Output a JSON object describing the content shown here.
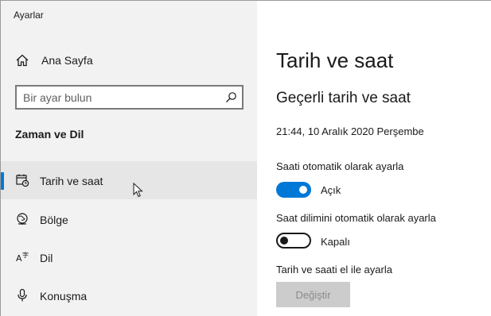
{
  "app": {
    "title": "Ayarlar"
  },
  "sidebar": {
    "home_label": "Ana Sayfa",
    "search_placeholder": "Bir ayar bulun",
    "section_title": "Zaman ve Dil",
    "items": [
      {
        "label": "Tarih ve saat",
        "icon": "calendar-clock-icon",
        "selected": true
      },
      {
        "label": "Bölge",
        "icon": "globe-icon",
        "selected": false
      },
      {
        "label": "Dil",
        "icon": "language-icon",
        "selected": false
      },
      {
        "label": "Konuşma",
        "icon": "microphone-icon",
        "selected": false
      }
    ]
  },
  "main": {
    "page_title": "Tarih ve saat",
    "sub_title": "Geçerli tarih ve saat",
    "current_datetime": "21:44, 10 Aralık 2020 Perşembe",
    "auto_time": {
      "label": "Saati otomatik olarak ayarla",
      "state_label": "Açık",
      "on": true
    },
    "auto_timezone": {
      "label": "Saat dilimini otomatik olarak ayarla",
      "state_label": "Kapalı",
      "on": false
    },
    "manual": {
      "label": "Tarih ve saati el ile ayarla",
      "button_label": "Değiştir",
      "disabled": true
    }
  },
  "colors": {
    "accent": "#0078d7",
    "sidebar_bg": "#f2f2f2",
    "selected_bg": "#e6e6e6"
  }
}
